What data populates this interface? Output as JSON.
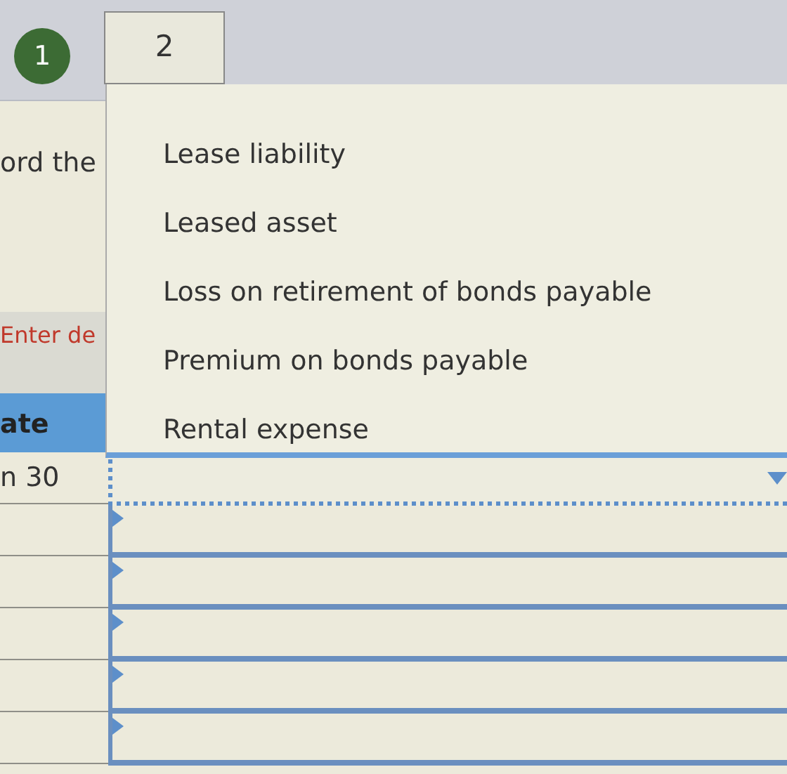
{
  "steps": [
    {
      "label": "1",
      "selected": false
    },
    {
      "label": "2",
      "selected": true
    }
  ],
  "instruction": "ord the",
  "hint": "Enter de",
  "table": {
    "columns": [
      "ate"
    ],
    "rows": [
      {
        "date": "n 30",
        "selected": true
      },
      {
        "selected": false
      },
      {
        "selected": false
      },
      {
        "selected": false
      },
      {
        "selected": false
      },
      {
        "selected": false
      }
    ]
  },
  "dropdown": {
    "expanded": true,
    "options": [
      "Lease liability",
      "Leased asset",
      "Loss on retirement of bonds payable",
      "Premium on bonds payable",
      "Rental expense"
    ]
  }
}
